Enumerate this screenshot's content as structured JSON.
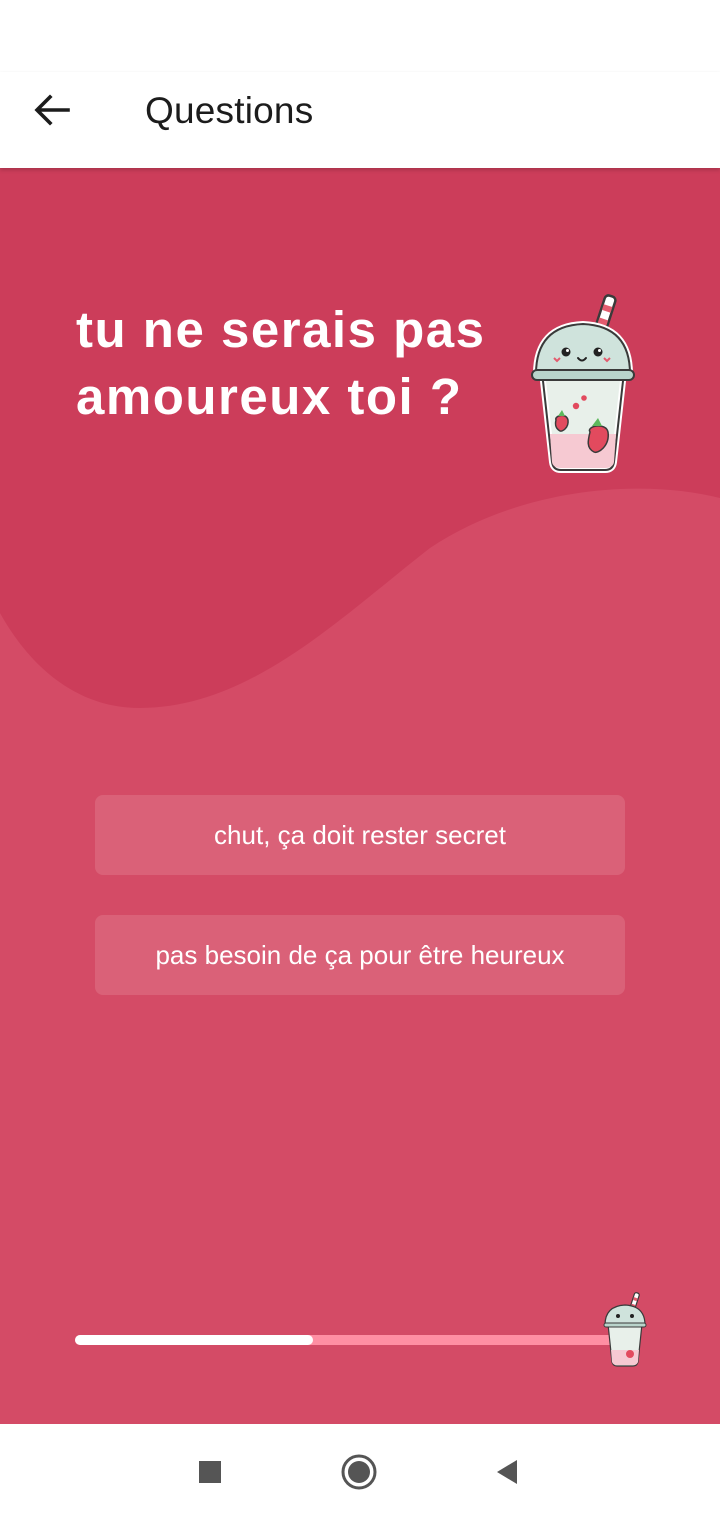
{
  "toolbar": {
    "title": "Questions",
    "back_icon": "arrow-left-icon"
  },
  "question": {
    "text": "tu ne serais pas amoureux toi ?",
    "illustration": "strawberry-milkshake-cup"
  },
  "answers": [
    {
      "label": "chut, ça doit rester secret"
    },
    {
      "label": "pas besoin de ça pour être heureux"
    }
  ],
  "progress": {
    "fraction": 0.44,
    "marker_icon": "milkshake-cup-icon"
  },
  "navigation_bar": {
    "buttons": [
      "recents-square-icon",
      "home-circle-icon",
      "back-triangle-icon"
    ]
  },
  "colors": {
    "background": "#d44b66",
    "wave_dark": "#cc3d5a",
    "answer_fill": "rgba(230,140,155,0.35)",
    "progress_track": "#ff8fa3",
    "progress_fill": "#ffffff",
    "text_on_accent": "#ffffff"
  }
}
